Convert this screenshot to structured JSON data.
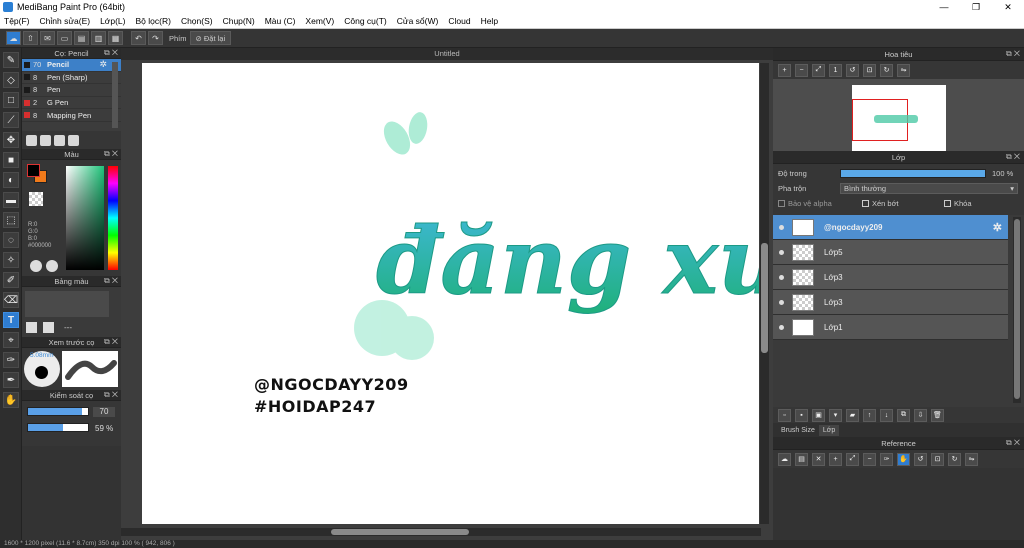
{
  "window": {
    "title": "MediBang Paint Pro (64bit)",
    "minimize": "—",
    "maximize": "❐",
    "close": "✕"
  },
  "menu": [
    "Tệp(F)",
    "Chỉnh sửa(E)",
    "Lớp(L)",
    "Bộ lọc(R)",
    "Chọn(S)",
    "Chụp(N)",
    "Màu (C)",
    "Xem(V)",
    "Công cụ(T)",
    "Cửa sổ(W)",
    "Cloud",
    "Help"
  ],
  "toolbar": {
    "key_label": "Phím",
    "reset_label": "Đặt lại"
  },
  "brush_panel": {
    "title": "Cọ: Pencil",
    "items": [
      {
        "size": "70",
        "name": "Pencil",
        "color": "#1a1a1a"
      },
      {
        "size": "8",
        "name": "Pen (Sharp)",
        "color": "#1a1a1a"
      },
      {
        "size": "8",
        "name": "Pen",
        "color": "#1a1a1a"
      },
      {
        "size": "2",
        "name": "G Pen",
        "color": "#d62f2f"
      },
      {
        "size": "8",
        "name": "Mapping Pen",
        "color": "#d62f2f"
      }
    ]
  },
  "color_panel": {
    "title": "Màu",
    "r": "R:0",
    "g": "G:0",
    "b": "B:0",
    "hex": "#000000"
  },
  "palette_panel": {
    "title": "Bảng màu",
    "placeholder": "---"
  },
  "brush_preview": {
    "title": "Xem trước cọ",
    "size": "5.08mm"
  },
  "brush_control": {
    "title": "Kiểm soát cọ",
    "size_value": "70",
    "opacity_value": "59 %"
  },
  "canvas": {
    "doc_title": "Untitled",
    "art_text": "đăng xu",
    "handle": "@NGOCDAYY209",
    "tag": "#HOIDAP247"
  },
  "navigator": {
    "title": "Hoa tiêu"
  },
  "layer_panel": {
    "title": "Lớp",
    "opacity_label": "Độ trong",
    "opacity_value": "100 %",
    "blend_label": "Pha trộn",
    "blend_value": "Bình thường",
    "protect_alpha": "Bảo vệ alpha",
    "clipping": "Xén bớt",
    "lock": "Khóa",
    "layers": [
      {
        "name": "@ngocdayy209",
        "selected": true
      },
      {
        "name": "Lớp5",
        "selected": false
      },
      {
        "name": "Lớp3",
        "selected": false
      },
      {
        "name": "Lớp3",
        "selected": false
      },
      {
        "name": "Lớp1",
        "selected": false
      }
    ],
    "tabs": [
      "Brush Size",
      "Lớp"
    ]
  },
  "reference_panel": {
    "title": "Reference"
  },
  "status": "1600 * 1200 pixel   (11.6 * 8.7cm)  350 dpi   100 %   ( 942, 806 )",
  "colors": {
    "accent": "#2f7dd1",
    "teal_light": "#3fc1d4",
    "teal_dark": "#1fb07a"
  }
}
